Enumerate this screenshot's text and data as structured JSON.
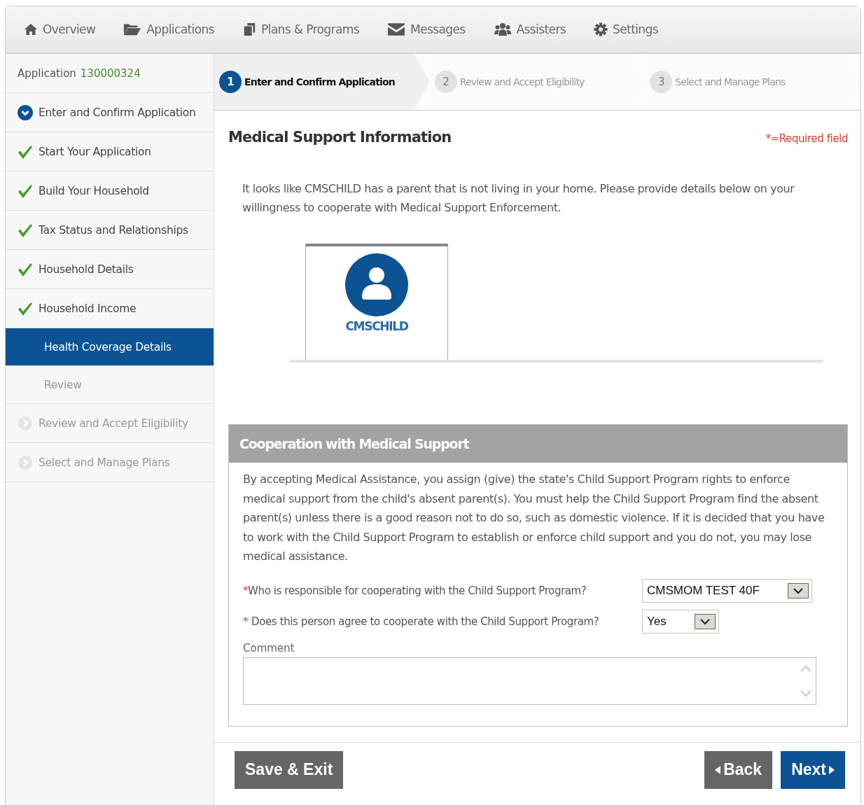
{
  "nav": [
    {
      "label": "Overview"
    },
    {
      "label": "Applications"
    },
    {
      "label": "Plans & Programs"
    },
    {
      "label": "Messages"
    },
    {
      "label": "Assisters"
    },
    {
      "label": "Settings"
    }
  ],
  "sidebar": {
    "application_label": "Application",
    "application_number": "130000324",
    "items": [
      {
        "label": "Enter and Confirm Application",
        "kind": "current",
        "selected": false
      },
      {
        "label": "Start Your Application",
        "kind": "done",
        "selected": false
      },
      {
        "label": "Build Your Household",
        "kind": "done",
        "selected": false
      },
      {
        "label": "Tax Status and Relationships",
        "kind": "done",
        "selected": false
      },
      {
        "label": "Household Details",
        "kind": "done",
        "selected": false
      },
      {
        "label": "Household Income",
        "kind": "done",
        "selected": false
      },
      {
        "label": "Health Coverage Details",
        "kind": "substep",
        "selected": true
      },
      {
        "label": "Review",
        "kind": "lockedsubstep",
        "selected": false
      },
      {
        "label": "Review and Accept Eligibility",
        "kind": "locked",
        "selected": false
      },
      {
        "label": "Select and Manage Plans",
        "kind": "locked",
        "selected": false
      }
    ]
  },
  "steps": [
    {
      "number": "1",
      "label": "Enter and Confirm Application",
      "selected": true
    },
    {
      "number": "2",
      "label": "Review and Accept Eligibility",
      "selected": false
    },
    {
      "number": "3",
      "label": "Select and Manage Plans",
      "selected": false
    }
  ],
  "page_title": "Medical Support Information",
  "required_note": "*=Required field",
  "intro": "It looks like CMSCHILD has a parent that is not living in your home. Please provide details below on your willingness to cooperate with Medical Support Enforcement.",
  "person_tabs": [
    {
      "name": "CMSCHILD",
      "selected": true
    }
  ],
  "section": {
    "title": "Cooperation with Medical Support",
    "text": "By accepting Medical Assistance, you assign (give) the state's Child Support Program rights to enforce medical support from the child's absent parent(s). You must help the Child Support Program find the absent parent(s) unless there is a good reason not to do so, such as domestic violence. If it is decided that you have to work with the Child Support Program to establish or enforce child support and you do not, you may lose medical assistance.",
    "questions": [
      {
        "mark": "*",
        "label": "Who is responsible for cooperating with the Child Support Program?",
        "value": "CMSMOM TEST 40F"
      },
      {
        "mark": "*",
        "label": "Does this person agree to cooperate with the Child Support Program?",
        "value": "Yes"
      }
    ],
    "comment_label": "Comment"
  },
  "buttons": {
    "save": "Save & Exit",
    "back": "Back",
    "next": "Next"
  }
}
